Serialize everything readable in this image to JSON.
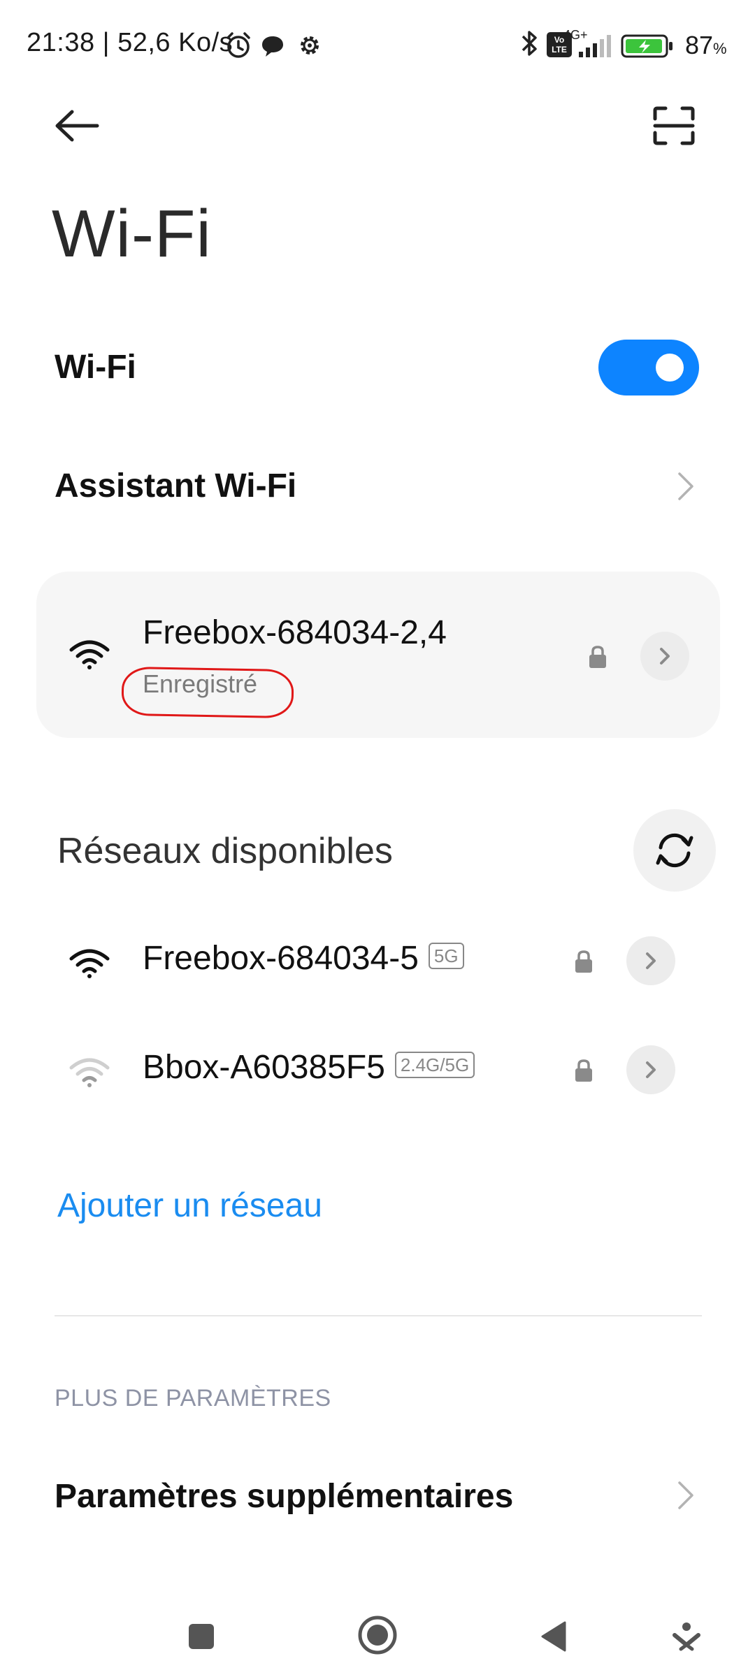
{
  "status_bar": {
    "left_text": "21:38 | 52,6 Ko/s",
    "battery_percent": "87",
    "battery_unit": "%",
    "volte_label": "Vo LTE",
    "network_type": "4G+"
  },
  "header": {
    "title": "Wi-Fi"
  },
  "wifi_toggle": {
    "label": "Wi-Fi",
    "state": "on",
    "accent_color": "#0d84ff"
  },
  "assistant": {
    "label": "Assistant Wi-Fi"
  },
  "saved_network": {
    "name": "Freebox-684034-2,4",
    "status": "Enregistré",
    "secured": true
  },
  "available": {
    "heading": "Réseaux disponibles",
    "networks": [
      {
        "name": "Freebox-684034-5",
        "band": "5G",
        "signal": "strong",
        "secured": true
      },
      {
        "name": "Bbox-A60385F5",
        "band": "2.4G/5G",
        "signal": "weak",
        "secured": true
      }
    ],
    "add_label": "Ajouter un réseau"
  },
  "more": {
    "section_label": "PLUS DE PARAMÈTRES",
    "extra_settings_label": "Paramètres supplémentaires"
  }
}
